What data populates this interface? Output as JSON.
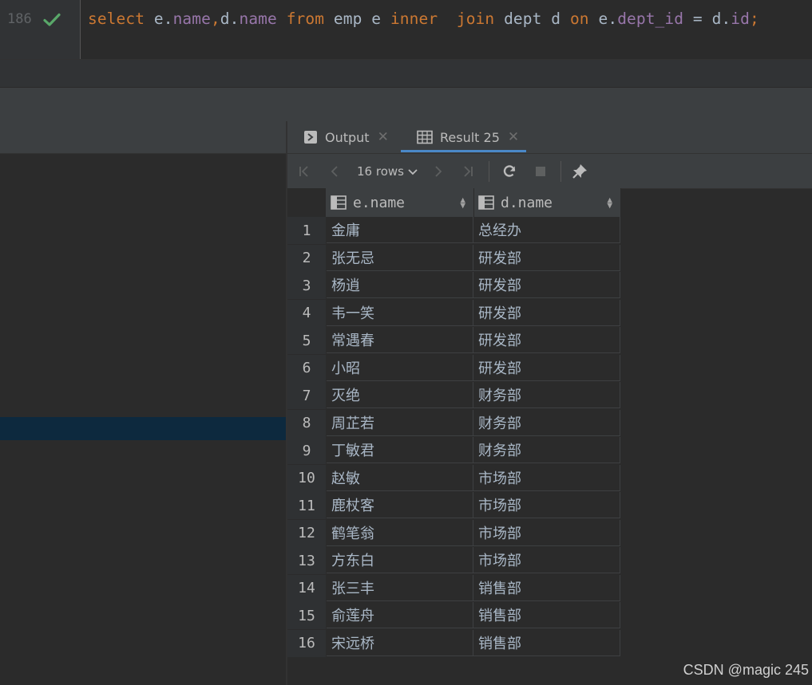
{
  "editor": {
    "line_number": "186",
    "status_icon": "check-icon",
    "code_tokens": [
      {
        "text": "select",
        "kind": "kw"
      },
      {
        "text": " e.",
        "kind": "pl"
      },
      {
        "text": "name",
        "kind": "fld"
      },
      {
        "text": ",",
        "kind": "kw"
      },
      {
        "text": "d.",
        "kind": "pl"
      },
      {
        "text": "name",
        "kind": "fld"
      },
      {
        "text": " ",
        "kind": "pl"
      },
      {
        "text": "from",
        "kind": "kw"
      },
      {
        "text": " emp e ",
        "kind": "pl"
      },
      {
        "text": "inner",
        "kind": "kw"
      },
      {
        "text": "  ",
        "kind": "pl"
      },
      {
        "text": "join",
        "kind": "kw"
      },
      {
        "text": " dept d ",
        "kind": "pl"
      },
      {
        "text": "on",
        "kind": "kw"
      },
      {
        "text": " e.",
        "kind": "pl"
      },
      {
        "text": "dept_id",
        "kind": "fld"
      },
      {
        "text": " = d.",
        "kind": "pl"
      },
      {
        "text": "id",
        "kind": "fld"
      },
      {
        "text": ";",
        "kind": "kw"
      }
    ]
  },
  "tabs": [
    {
      "label": "Output",
      "icon": "console-icon",
      "active": false
    },
    {
      "label": "Result 25",
      "icon": "table-icon",
      "active": true
    }
  ],
  "toolbar": {
    "rows_label": "16 rows",
    "buttons": [
      "first-page-icon",
      "previous-page-icon",
      "next-page-icon",
      "last-page-icon",
      "refresh-icon",
      "stop-icon",
      "pin-icon"
    ]
  },
  "grid": {
    "columns": [
      "e.name",
      "d.name"
    ],
    "rows": [
      {
        "n": "1",
        "e_name": "金庸",
        "d_name": "总经办"
      },
      {
        "n": "2",
        "e_name": "张无忌",
        "d_name": "研发部"
      },
      {
        "n": "3",
        "e_name": "杨逍",
        "d_name": "研发部"
      },
      {
        "n": "4",
        "e_name": "韦一笑",
        "d_name": "研发部"
      },
      {
        "n": "5",
        "e_name": "常遇春",
        "d_name": "研发部"
      },
      {
        "n": "6",
        "e_name": "小昭",
        "d_name": "研发部"
      },
      {
        "n": "7",
        "e_name": "灭绝",
        "d_name": "财务部"
      },
      {
        "n": "8",
        "e_name": "周芷若",
        "d_name": "财务部"
      },
      {
        "n": "9",
        "e_name": "丁敏君",
        "d_name": "财务部"
      },
      {
        "n": "10",
        "e_name": "赵敏",
        "d_name": "市场部"
      },
      {
        "n": "11",
        "e_name": "鹿杖客",
        "d_name": "市场部"
      },
      {
        "n": "12",
        "e_name": "鹤笔翁",
        "d_name": "市场部"
      },
      {
        "n": "13",
        "e_name": "方东白",
        "d_name": "市场部"
      },
      {
        "n": "14",
        "e_name": "张三丰",
        "d_name": "销售部"
      },
      {
        "n": "15",
        "e_name": "俞莲舟",
        "d_name": "销售部"
      },
      {
        "n": "16",
        "e_name": "宋远桥",
        "d_name": "销售部"
      }
    ]
  },
  "watermark": "CSDN @magic 245",
  "colors": {
    "keyword": "#cc7832",
    "field": "#9876aa",
    "plain": "#a9b7c6",
    "check": "#59a869",
    "tab_underline": "#4a88c7",
    "selection": "#0d293e"
  }
}
